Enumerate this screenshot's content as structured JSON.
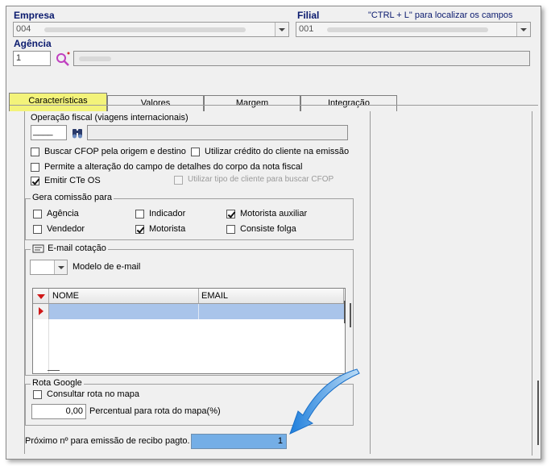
{
  "header": {
    "empresa_label": "Empresa",
    "empresa_value": "004",
    "filial_label": "Filial",
    "filial_value": "001",
    "hint": "\"CTRL + L\" para localizar os campos",
    "agencia_label": "Agência",
    "agencia_value": "1"
  },
  "tabs": [
    {
      "label": "Características"
    },
    {
      "label": "Valores"
    },
    {
      "label": "Margem"
    },
    {
      "label": "Integração"
    }
  ],
  "operacao": {
    "label": "Operação fiscal (viagens internacionais)",
    "value": "____"
  },
  "options": {
    "buscar_cfop": {
      "label": "Buscar CFOP pela origem e destino",
      "checked": false
    },
    "utilizar_credito": {
      "label": "Utilizar crédito do cliente na emissão",
      "checked": false
    },
    "permite_alteracao": {
      "label": "Permite a alteração do campo de detalhes do corpo da nota fiscal",
      "checked": false
    },
    "emitir_cte_os": {
      "label": "Emitir CTe OS",
      "checked": true
    },
    "utilizar_tipo_cliente": {
      "label": "Utilizar tipo de cliente para buscar CFOP",
      "checked": false,
      "disabled": true
    }
  },
  "comissao": {
    "title": "Gera comissão para",
    "agencia": {
      "label": "Agência",
      "checked": false
    },
    "indicador": {
      "label": "Indicador",
      "checked": false
    },
    "motorista_auxiliar": {
      "label": "Motorista auxiliar",
      "checked": true
    },
    "vendedor": {
      "label": "Vendedor",
      "checked": false
    },
    "motorista": {
      "label": "Motorista",
      "checked": true
    },
    "consiste_folga": {
      "label": "Consiste folga",
      "checked": false
    }
  },
  "email": {
    "title": "E-mail cotação",
    "modelo_label": "Modelo de e-mail",
    "columns": [
      "NOME",
      "EMAIL"
    ]
  },
  "rota": {
    "title": "Rota Google",
    "consultar": {
      "label": "Consultar rota no mapa",
      "checked": false
    },
    "percentual_value": "0,00",
    "percentual_label": "Percentual para rota do mapa(%)"
  },
  "recibo": {
    "label": "Próximo nº para emissão de recibo pagto.",
    "value": "1"
  },
  "colors": {
    "title_blue": "#0a1a6e",
    "active_tab": "#f3f37a",
    "highlight": "#74aee6",
    "arrow": "#2f8fe0"
  }
}
